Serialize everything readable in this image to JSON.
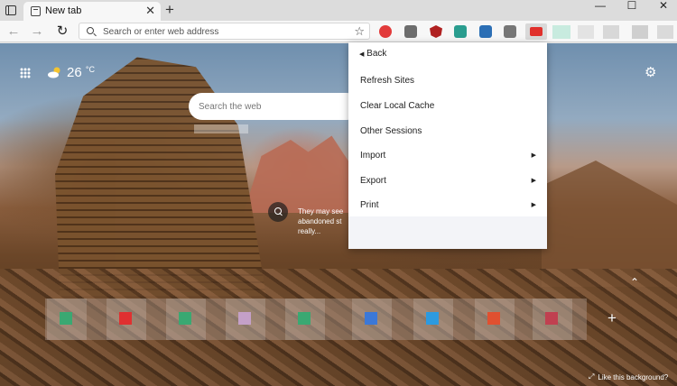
{
  "browser": {
    "tab": {
      "title": "New tab",
      "close": "✕"
    },
    "new_tab": "+",
    "window_controls": [
      "—",
      "☐",
      "✕"
    ],
    "nav": {
      "back": "←",
      "forward": "→",
      "reload": "↻"
    },
    "address": {
      "placeholder": "Search or enter web address"
    },
    "favorite_icon": "☆",
    "extensions": [
      "#e23b3b",
      "#6d6d6d",
      "#b02020",
      "#2a9d8f",
      "#2c6fb5",
      "#777777",
      "#e0302c"
    ]
  },
  "page": {
    "weather": {
      "temperature": "26",
      "unit": "°C"
    },
    "search": {
      "placeholder": "Search the web"
    },
    "background_info": {
      "lines": [
        "They may see",
        "abandoned st",
        "really..."
      ]
    },
    "tiles": [
      "#3aa872",
      "#e03030",
      "#3aa872",
      "#c4a0c8",
      "#3aa872",
      "#3b78d8",
      "#2c9ae0",
      "#e05030",
      "#c04050"
    ],
    "add_tile": "+",
    "like_background": "Like this background?"
  },
  "menu": {
    "items": [
      {
        "label": "Back",
        "submenu": false,
        "is_back": true
      },
      {
        "label": "Refresh Sites",
        "submenu": false
      },
      {
        "label": "Clear Local Cache",
        "submenu": false
      },
      {
        "label": "Other Sessions",
        "submenu": false
      },
      {
        "label": "Import",
        "submenu": true
      },
      {
        "label": "Export",
        "submenu": true
      },
      {
        "label": "Print",
        "submenu": true
      }
    ]
  }
}
